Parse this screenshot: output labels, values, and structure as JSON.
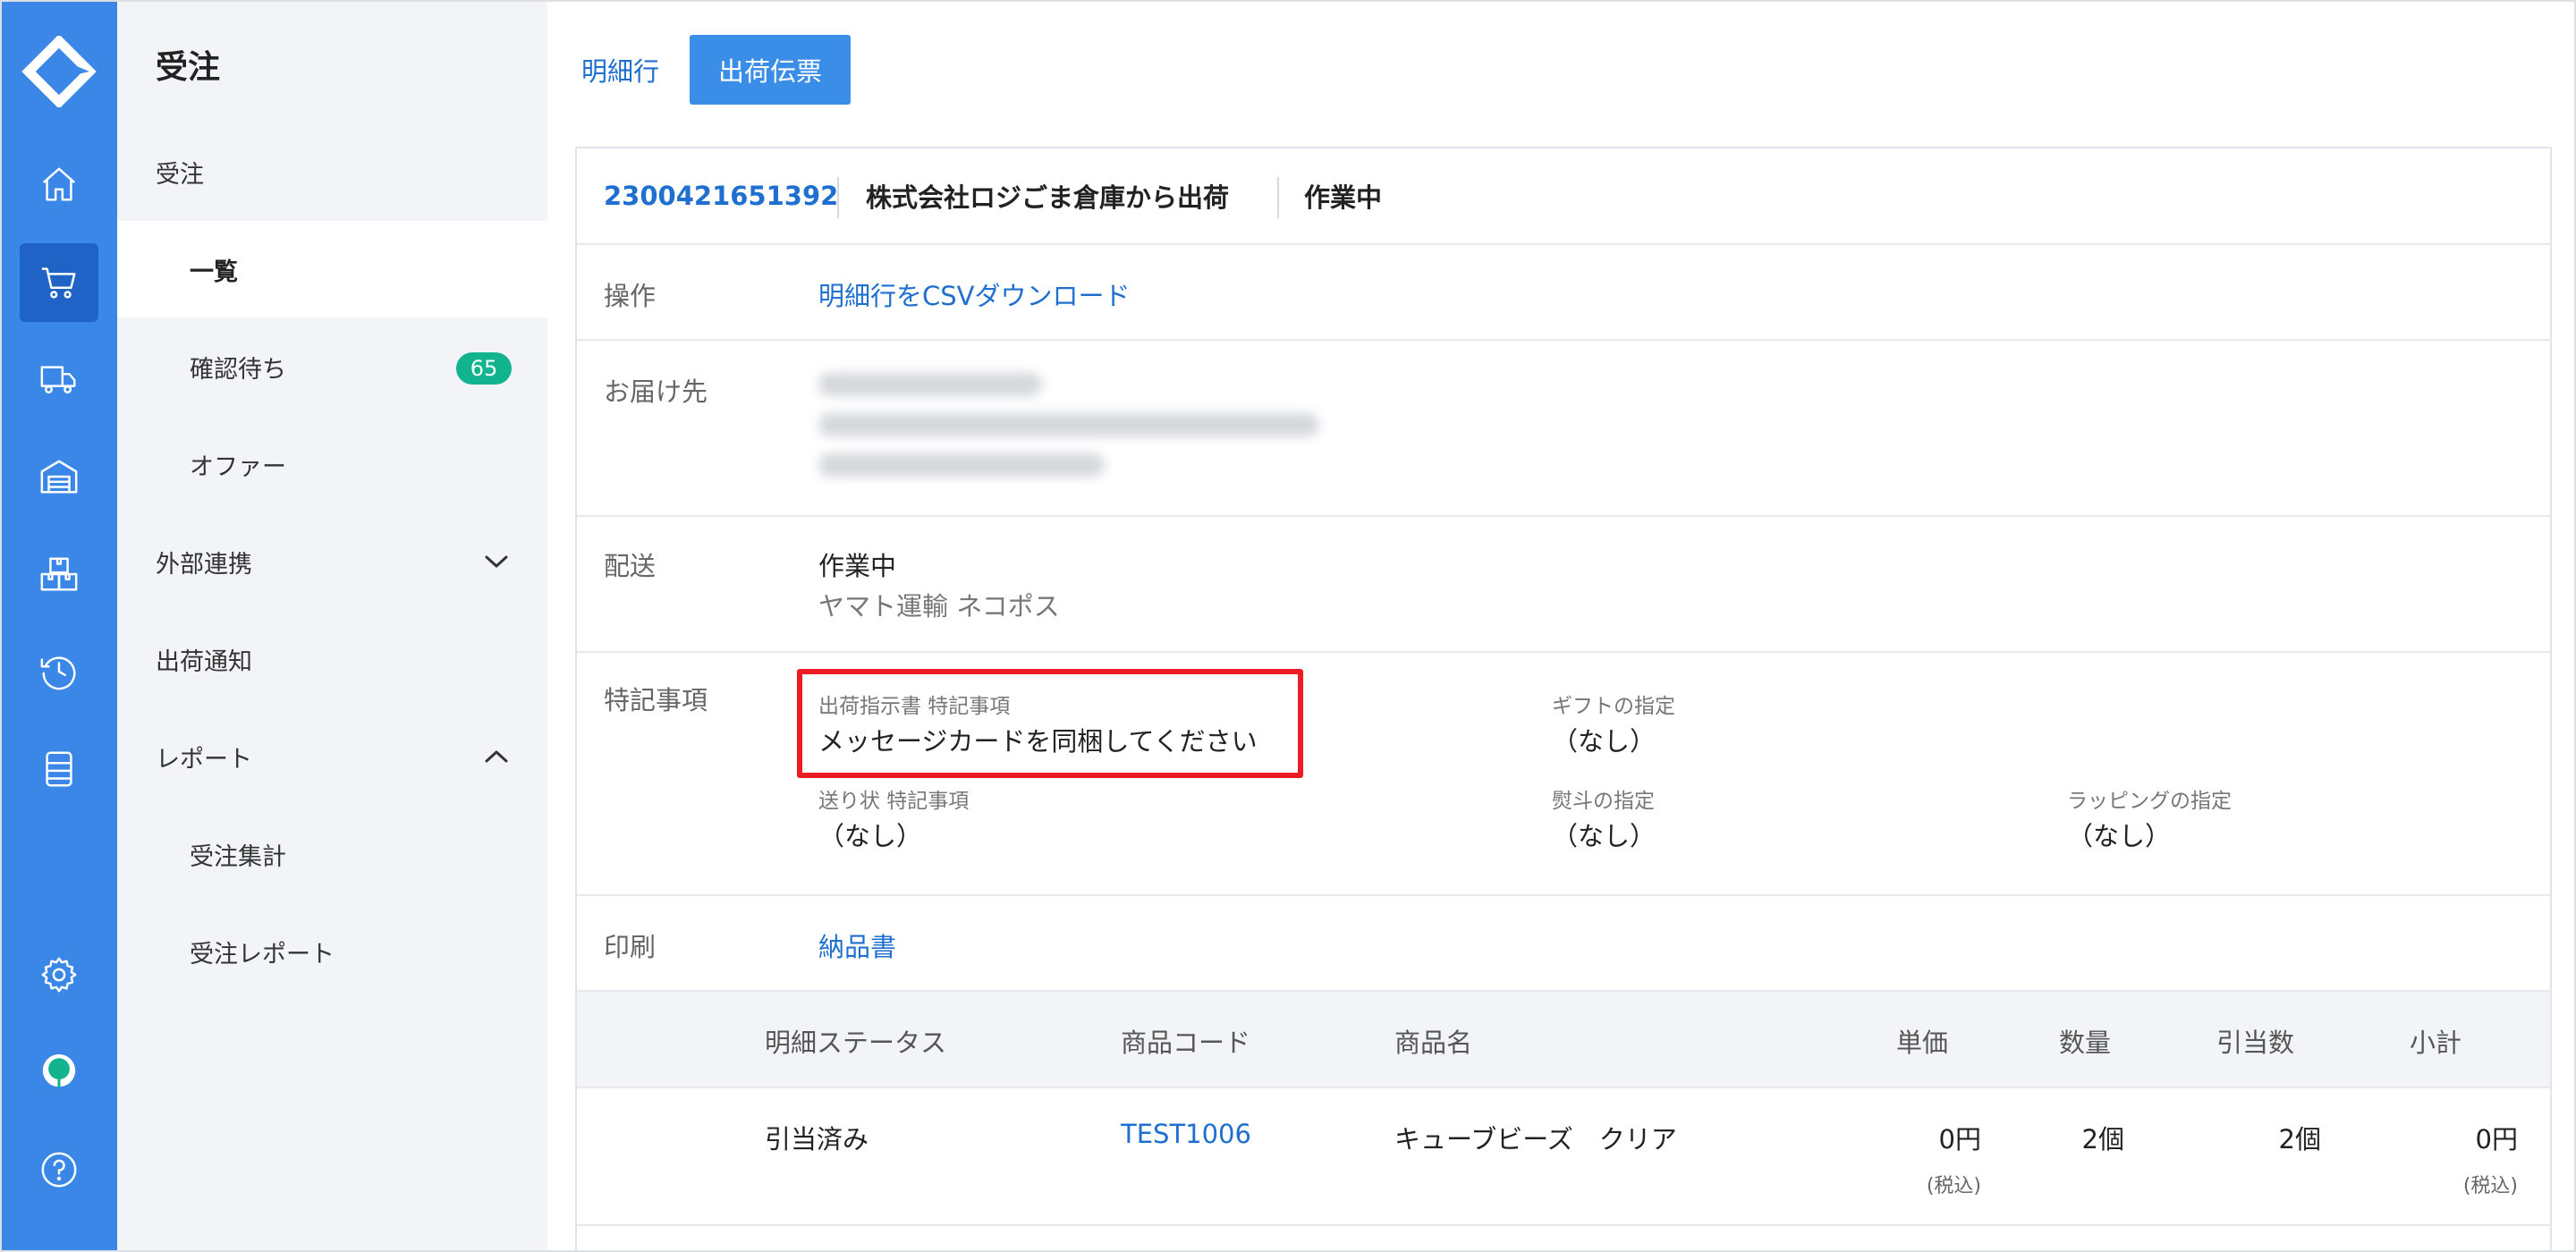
{
  "rail": {
    "accent": "#3a87e8",
    "active_bg": "#1f63c7",
    "items": [
      {
        "icon": "home-icon"
      },
      {
        "icon": "cart-icon"
      },
      {
        "icon": "truck-icon"
      },
      {
        "icon": "warehouse-icon"
      },
      {
        "icon": "boxes-icon"
      },
      {
        "icon": "history-icon"
      },
      {
        "icon": "database-icon"
      },
      {
        "icon": "gear-icon"
      },
      {
        "icon": "balloon-icon"
      },
      {
        "icon": "help-icon"
      }
    ]
  },
  "sidebar": {
    "title": "受注",
    "items": [
      {
        "label": "受注"
      },
      {
        "label": "一覧"
      },
      {
        "label": "確認待ち",
        "badge": "65"
      },
      {
        "label": "オファー"
      },
      {
        "label": "外部連携"
      },
      {
        "label": "出荷通知"
      },
      {
        "label": "レポート"
      },
      {
        "label": "受注集計"
      },
      {
        "label": "受注レポート"
      }
    ]
  },
  "tabs": {
    "details": "明細行",
    "shipping_slip": "出荷伝票"
  },
  "order": {
    "id": "2300421651392",
    "warehouse": "株式会社ロジごま倉庫から出荷",
    "status": "作業中"
  },
  "rows": {
    "operation": {
      "label": "操作",
      "link": "明細行をCSVダウンロード"
    },
    "delivery": {
      "label": "お届け先"
    },
    "shipping": {
      "label": "配送",
      "status": "作業中",
      "carrier": "ヤマト運輸 ネコポス"
    },
    "notes": {
      "label": "特記事項",
      "instruction_title": "出荷指示書 特記事項",
      "instruction_value": "メッセージカードを同梱してください",
      "gift_title": "ギフトの指定",
      "gift_value": "（なし）",
      "invoice_title": "送り状 特記事項",
      "invoice_value": "（なし）",
      "noshi_title": "熨斗の指定",
      "noshi_value": "（なし）",
      "wrapping_title": "ラッピングの指定",
      "wrapping_value": "（なし）"
    },
    "print": {
      "label": "印刷",
      "link": "納品書"
    }
  },
  "table": {
    "headers": [
      "明細ステータス",
      "商品コード",
      "商品名",
      "単価",
      "数量",
      "引当数",
      "小計"
    ],
    "rows": [
      {
        "status": "引当済み",
        "code": "TEST1006",
        "name": "キューブビーズ　クリア",
        "price": "0円",
        "price_note": "(税込)",
        "qty": "2個",
        "allocated": "2個",
        "subtotal": "0円",
        "subtotal_note": "(税込)"
      }
    ]
  }
}
